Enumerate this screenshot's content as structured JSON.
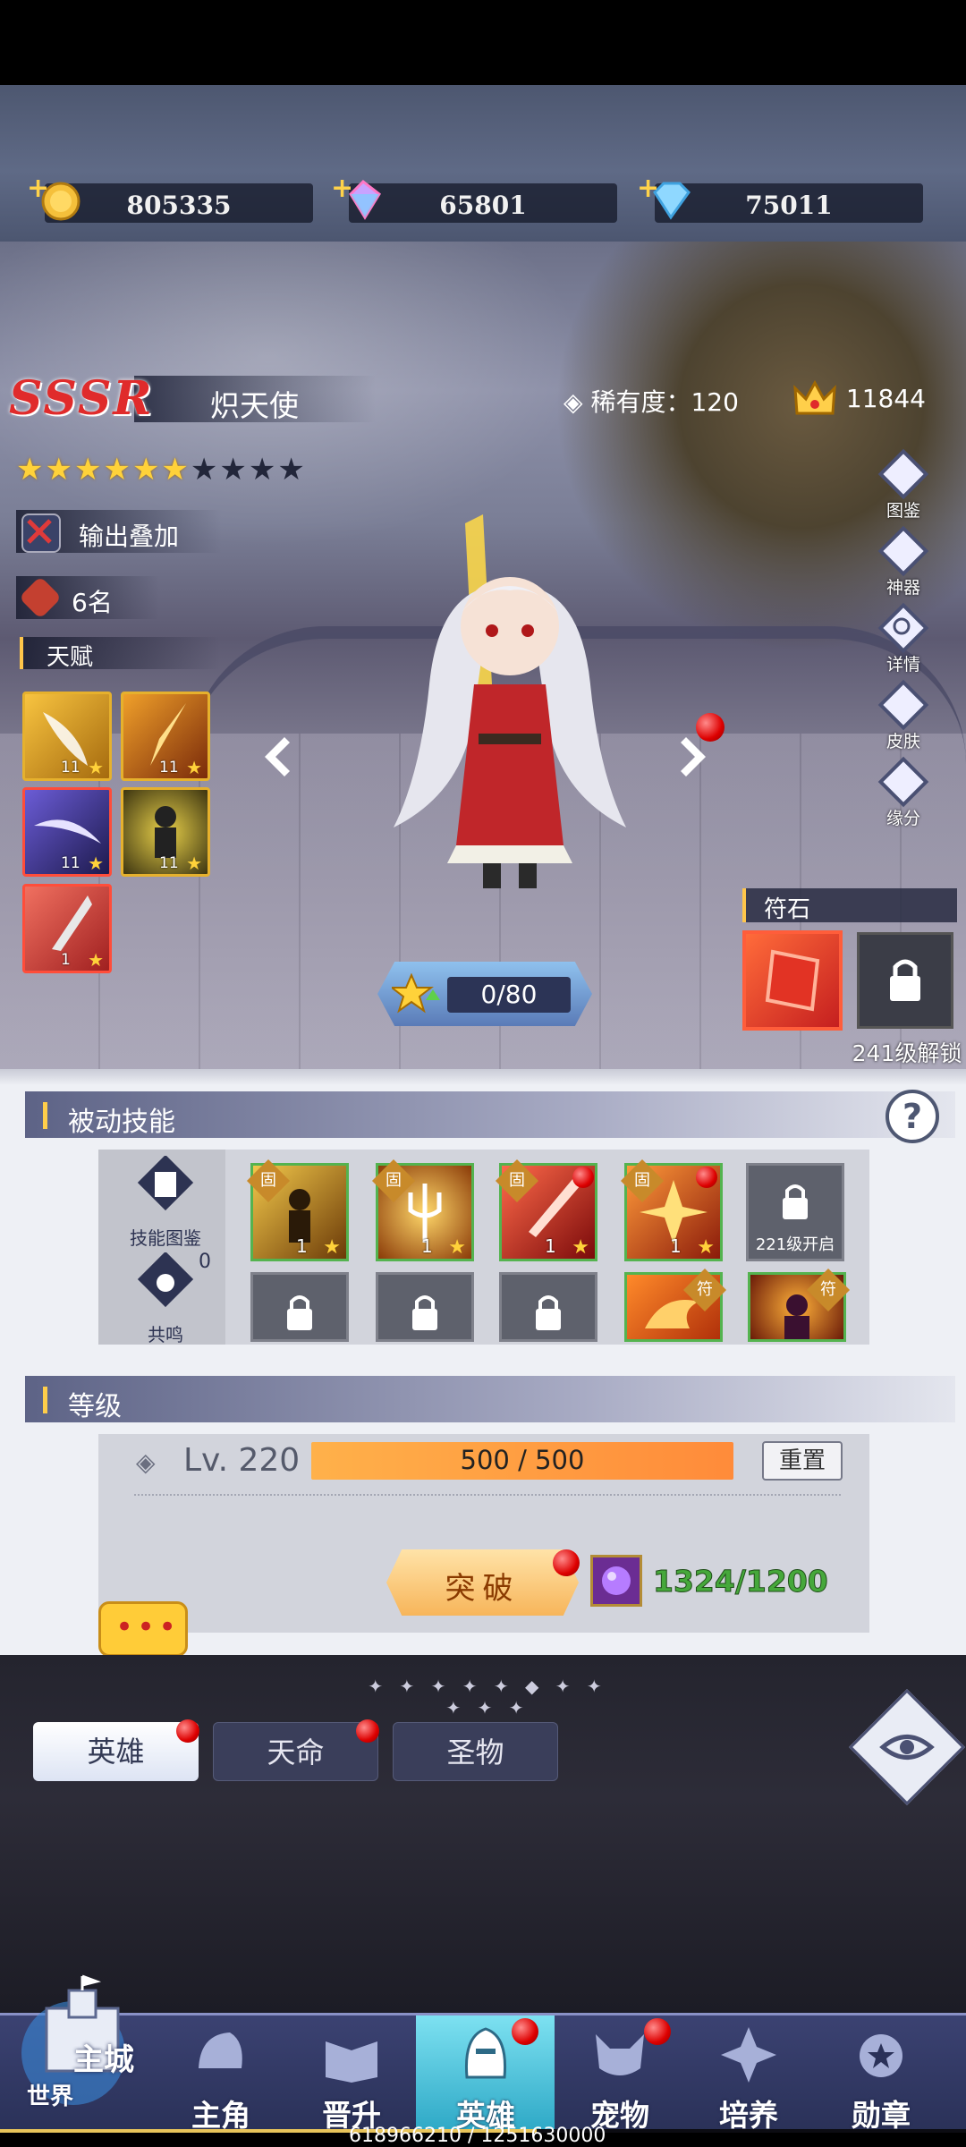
{
  "currency": {
    "gold": "805335",
    "crystal": "65801",
    "diamond": "75011"
  },
  "hero": {
    "rarity": "SSSR",
    "name": "炽天使",
    "rarity_label": "稀有度：",
    "rarity_value": "120",
    "power": "11844",
    "stars_filled": 6,
    "stars_total": 10,
    "tag_output": "输出叠加",
    "tag_rank": "6名",
    "talent_title": "天赋",
    "talents": [
      {
        "level": "11"
      },
      {
        "level": "11"
      },
      {
        "level": "11"
      },
      {
        "level": "11"
      },
      {
        "level": "1"
      }
    ],
    "exp_text": "0/80"
  },
  "side_buttons": [
    "图鉴",
    "神器",
    "详情",
    "皮肤",
    "缘分"
  ],
  "rune": {
    "title": "符石",
    "lock_text": "241级解锁"
  },
  "passive": {
    "title": "被动技能",
    "skill_codex": "技能图鉴",
    "resonance": "共鸣",
    "resonance_count": "0",
    "fixed_tag": "固",
    "owned_tag": "符",
    "skills": [
      {
        "level": "1"
      },
      {
        "level": "1"
      },
      {
        "level": "1"
      },
      {
        "level": "1"
      }
    ],
    "locked_text": "221级开启"
  },
  "level": {
    "title": "等级",
    "label": "Lv. 220",
    "bar_text": "500 / 500",
    "reset": "重置",
    "break_label": "突破",
    "break_cost": "1324/1200"
  },
  "chat": "•••",
  "divider": "✦ ✦ ✦ ✦ ✦ ◆ ✦ ✦ ✦ ✦ ✦",
  "tabs": [
    "英雄",
    "天命",
    "圣物"
  ],
  "nav": {
    "world": "世界",
    "main_city": "主城",
    "items": [
      "主角",
      "晋升",
      "英雄",
      "宠物",
      "培养",
      "勋章"
    ]
  },
  "footer": "618966210 / 1251630000",
  "colors": {
    "accent_gold": "#ffce4a",
    "sssr_red": "#e02b2b",
    "cost_green": "#46a83b"
  }
}
